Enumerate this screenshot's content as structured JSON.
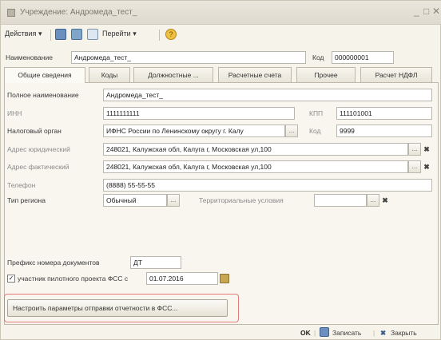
{
  "window": {
    "title": "Учреждение: Андромеда_тест_",
    "minimize": "_",
    "maximize": "□",
    "close": "✕"
  },
  "toolbar": {
    "actions_label": "Действия",
    "goto_label": "Перейти",
    "dropdown_arrow": "▾",
    "help_glyph": "?"
  },
  "header": {
    "name_label": "Наименование",
    "name_value": "Андромеда_тест_",
    "code_label": "Код",
    "code_value": "000000001"
  },
  "tabs": [
    {
      "label": "Общие сведения",
      "active": true
    },
    {
      "label": "Коды",
      "active": false
    },
    {
      "label": "Должностные ...",
      "active": false
    },
    {
      "label": "Расчетные счета",
      "active": false
    },
    {
      "label": "Прочее",
      "active": false
    },
    {
      "label": "Расчет НДФЛ",
      "active": false
    }
  ],
  "general": {
    "full_name_label": "Полное наименование",
    "full_name_value": "Андромеда_тест_",
    "inn_label": "ИНН",
    "inn_value": "1111111111",
    "kpp_label": "КПП",
    "kpp_value": "111101001",
    "tax_label": "Налоговый орган",
    "tax_value": "ИФНС России по Ленинскому округу г. Калу",
    "tax_code_label": "Код",
    "tax_code_value": "9999",
    "legal_address_label": "Адрес юридический",
    "legal_address_value": "248021, Калужская обл, Калуга г, Московская ул,100",
    "actual_address_label": "Адрес фактический",
    "actual_address_value": "248021, Калужская обл, Калуга г, Московская ул,100",
    "phone_label": "Телефон",
    "phone_value": "(8888) 55-55-55",
    "region_type_label": "Тип региона",
    "region_type_value": "Обычный",
    "territorial_label": "Территориальные условия",
    "territorial_value": "",
    "prefix_label": "Префикс номера документов",
    "prefix_value": "ДТ",
    "fss_pilot_label": "участник пилотного проекта ФСС с",
    "fss_pilot_checked": true,
    "fss_pilot_date": "01.07.2016",
    "fss_button_label": "Настроить параметры отправки отчетности в ФСС..."
  },
  "footer": {
    "ok_label": "OK",
    "save_label": "Записать",
    "close_label": "Закрыть",
    "divider": "|",
    "close_glyph": "✖"
  },
  "glyphs": {
    "ellipsis": "...",
    "clear": "✖",
    "check": "✓"
  },
  "colors": {
    "highlight_border": "#e27a7a",
    "panel_bg": "#f8f6ef"
  }
}
